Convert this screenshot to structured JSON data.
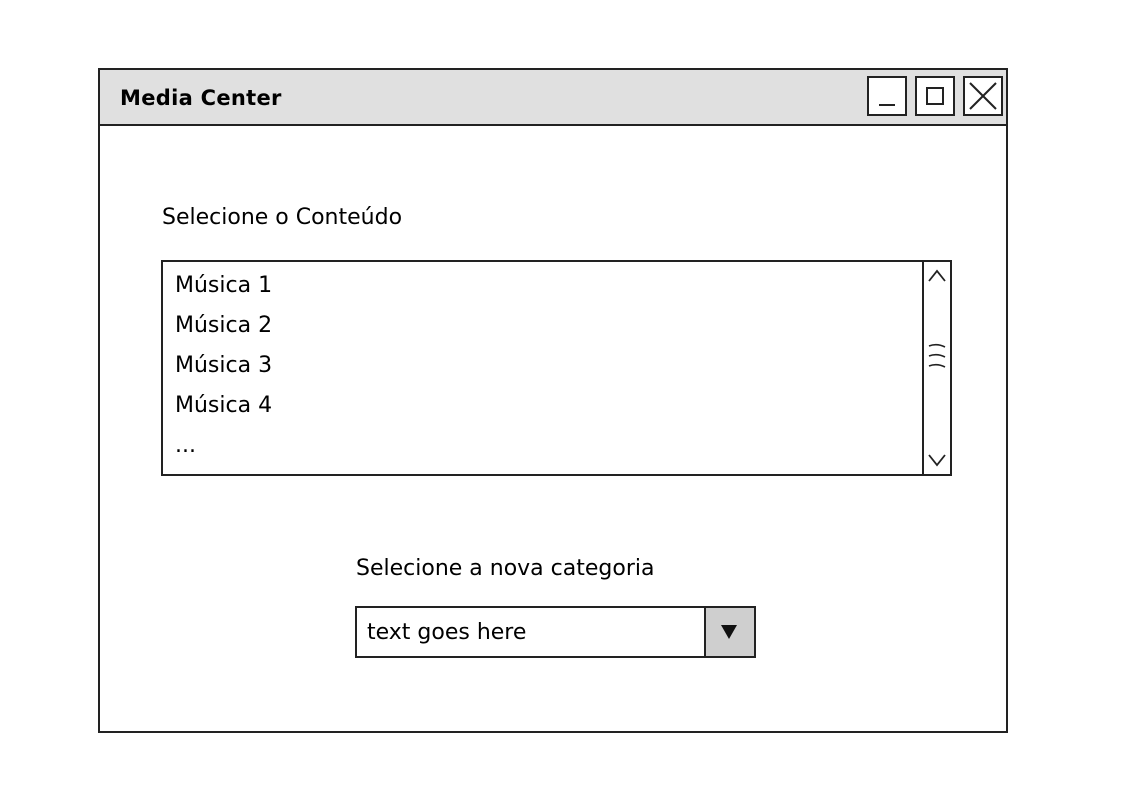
{
  "window": {
    "title": "Media Center",
    "controls": {
      "minimize_icon": "minimize-icon",
      "maximize_icon": "maximize-icon",
      "close_icon": "close-icon"
    }
  },
  "content_section": {
    "label": "Selecione o Conteúdo",
    "items": [
      "Música 1",
      "Música 2",
      "Música 3",
      "Música 4",
      "..."
    ],
    "scrollbar": {
      "up_icon": "chevron-up-icon",
      "down_icon": "chevron-down-icon",
      "thumb_icon": "grip-icon"
    }
  },
  "category_section": {
    "label": "Selecione a nova categoria",
    "dropdown_value": "text goes here",
    "dropdown_icon": "triangle-down-icon"
  },
  "colors": {
    "titlebar": "#e0e0e0",
    "dropdown_button": "#cfcfcf",
    "border": "#222222"
  }
}
